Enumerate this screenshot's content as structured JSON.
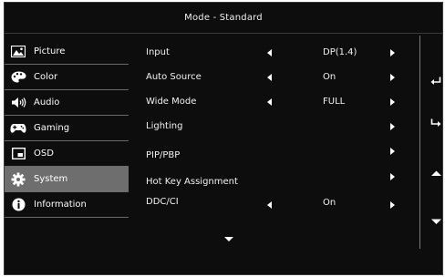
{
  "window": {
    "title": "Mode - Standard"
  },
  "sidebar": {
    "items": [
      {
        "label": "Picture",
        "icon": "picture-icon",
        "selected": false
      },
      {
        "label": "Color",
        "icon": "palette-icon",
        "selected": false
      },
      {
        "label": "Audio",
        "icon": "speaker-icon",
        "selected": false
      },
      {
        "label": "Gaming",
        "icon": "gamepad-icon",
        "selected": false
      },
      {
        "label": "OSD",
        "icon": "osd-window-icon",
        "selected": false
      },
      {
        "label": "System",
        "icon": "gear-icon",
        "selected": true
      },
      {
        "label": "Information",
        "icon": "info-icon",
        "selected": false
      }
    ]
  },
  "settings": {
    "rows": [
      {
        "label": "Input",
        "value": "DP(1.4)"
      },
      {
        "label": "Auto Source",
        "value": "On"
      },
      {
        "label": "Wide Mode",
        "value": "FULL"
      },
      {
        "label": "Lighting",
        "value": ""
      },
      {
        "label": "PIP/PBP",
        "value": ""
      },
      {
        "label": "Hot Key Assignment",
        "value": ""
      },
      {
        "label": "DDC/CI",
        "value": "On"
      }
    ]
  },
  "hints": {
    "icons": [
      "return-icon",
      "enter-icon",
      "up-arrow-icon",
      "down-arrow-icon"
    ]
  },
  "colors": {
    "background": "#0d0d0d",
    "selected": "#6e6e6e",
    "text": "#ffffff"
  }
}
